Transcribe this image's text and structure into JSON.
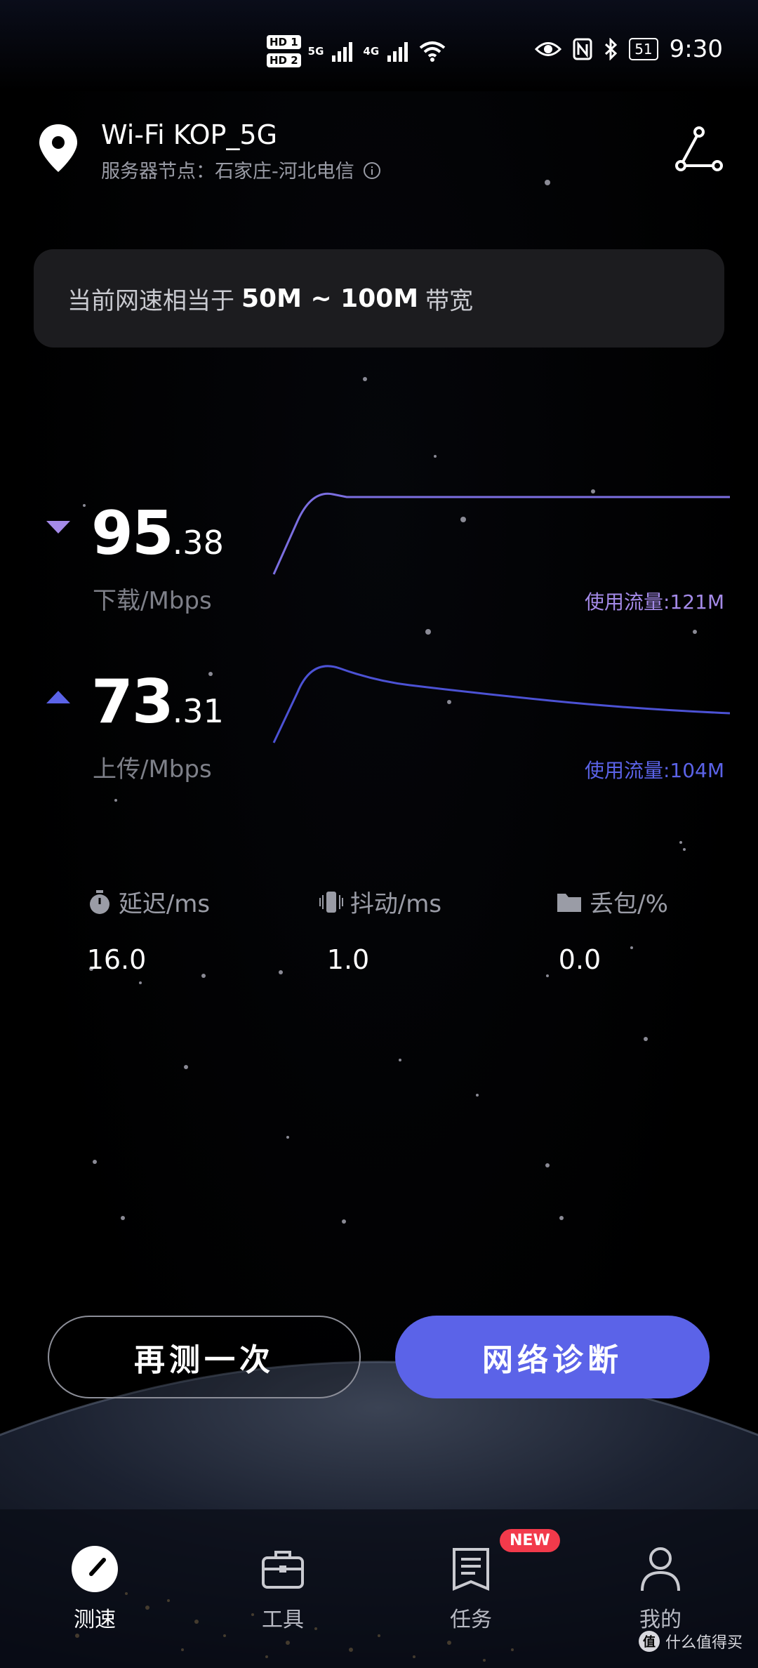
{
  "status_bar": {
    "hd1": "HD 1",
    "hd2": "HD 2",
    "net1": "5G",
    "net2": "4G",
    "battery": "51",
    "time": "9:30"
  },
  "header": {
    "wifi_name": "Wi-Fi KOP_5G",
    "server_node": "服务器节点：石家庄-河北电信"
  },
  "banner": {
    "prefix": "当前网速相当于",
    "range": "50M ~ 100M",
    "suffix": "带宽"
  },
  "download": {
    "int": "95",
    "dec": ".38",
    "unit": "下载/Mbps",
    "traffic": "使用流量:121M",
    "color": "#a48ae8"
  },
  "upload": {
    "int": "73",
    "dec": ".31",
    "unit": "上传/Mbps",
    "traffic": "使用流量:104M",
    "color": "#5b63e8"
  },
  "metrics": {
    "latency_label": "延迟/ms",
    "latency_value": "16.0",
    "jitter_label": "抖动/ms",
    "jitter_value": "1.0",
    "loss_label": "丢包/%",
    "loss_value": "0.0"
  },
  "buttons": {
    "retest": "再测一次",
    "diagnose": "网络诊断"
  },
  "tabs": [
    {
      "label": "测速",
      "icon": "speedometer-icon"
    },
    {
      "label": "工具",
      "icon": "toolbox-icon"
    },
    {
      "label": "任务",
      "icon": "task-list-icon"
    },
    {
      "label": "我的",
      "icon": "user-icon"
    }
  ],
  "new_badge": "NEW",
  "watermark": "什么值得买",
  "watermark_logo": "值"
}
